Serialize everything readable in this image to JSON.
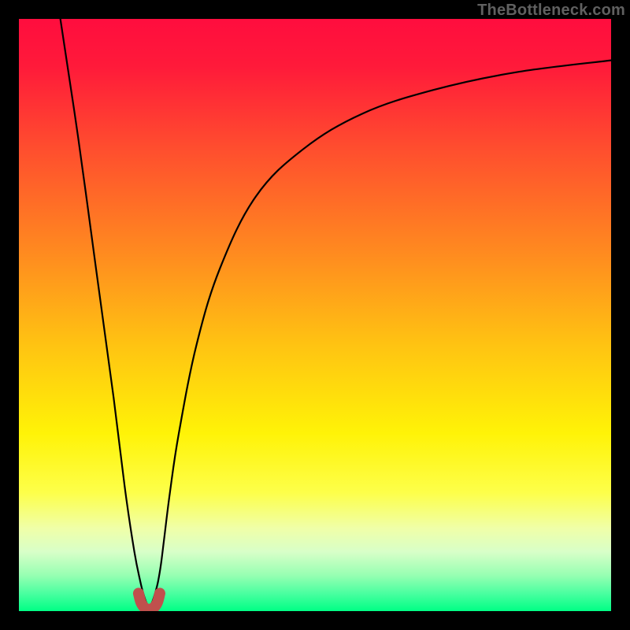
{
  "attribution": "TheBottleneck.com",
  "background": {
    "gradient_stops": [
      {
        "offset": 0.0,
        "color": "#ff0d3e"
      },
      {
        "offset": 0.08,
        "color": "#ff1a3a"
      },
      {
        "offset": 0.22,
        "color": "#ff4e2e"
      },
      {
        "offset": 0.4,
        "color": "#ff8c1f"
      },
      {
        "offset": 0.55,
        "color": "#ffc312"
      },
      {
        "offset": 0.7,
        "color": "#fff307"
      },
      {
        "offset": 0.8,
        "color": "#fdff4a"
      },
      {
        "offset": 0.86,
        "color": "#f0ffa8"
      },
      {
        "offset": 0.9,
        "color": "#d8ffc8"
      },
      {
        "offset": 0.94,
        "color": "#96ffb2"
      },
      {
        "offset": 0.97,
        "color": "#4affa0"
      },
      {
        "offset": 1.0,
        "color": "#00ff85"
      }
    ]
  },
  "chart_data": {
    "type": "line",
    "title": "",
    "xlabel": "",
    "ylabel": "",
    "xlim": [
      0,
      100
    ],
    "ylim": [
      0,
      100
    ],
    "series": [
      {
        "name": "curve",
        "x": [
          7,
          10,
          13,
          16,
          18,
          19.5,
          20.5,
          21,
          21.5,
          22,
          22.5,
          23,
          23.5,
          24,
          24.5,
          25.5,
          27,
          30,
          34,
          40,
          48,
          58,
          70,
          84,
          100
        ],
        "y": [
          100,
          80,
          58,
          36,
          20,
          10,
          5,
          3,
          1.5,
          0.8,
          1.5,
          3,
          5,
          8,
          12,
          20,
          30,
          45,
          58,
          70,
          78,
          84,
          88,
          91,
          93
        ]
      }
    ],
    "marker": {
      "name": "valley-marker",
      "color": "#c0504d",
      "x_range": [
        20.2,
        23.8
      ],
      "y_range": [
        0,
        3
      ],
      "points": [
        {
          "x": 20.2,
          "y": 3.0
        },
        {
          "x": 20.6,
          "y": 1.5
        },
        {
          "x": 21.2,
          "y": 0.6
        },
        {
          "x": 22.0,
          "y": 0.3
        },
        {
          "x": 22.8,
          "y": 0.6
        },
        {
          "x": 23.4,
          "y": 1.5
        },
        {
          "x": 23.8,
          "y": 3.0
        }
      ]
    }
  }
}
